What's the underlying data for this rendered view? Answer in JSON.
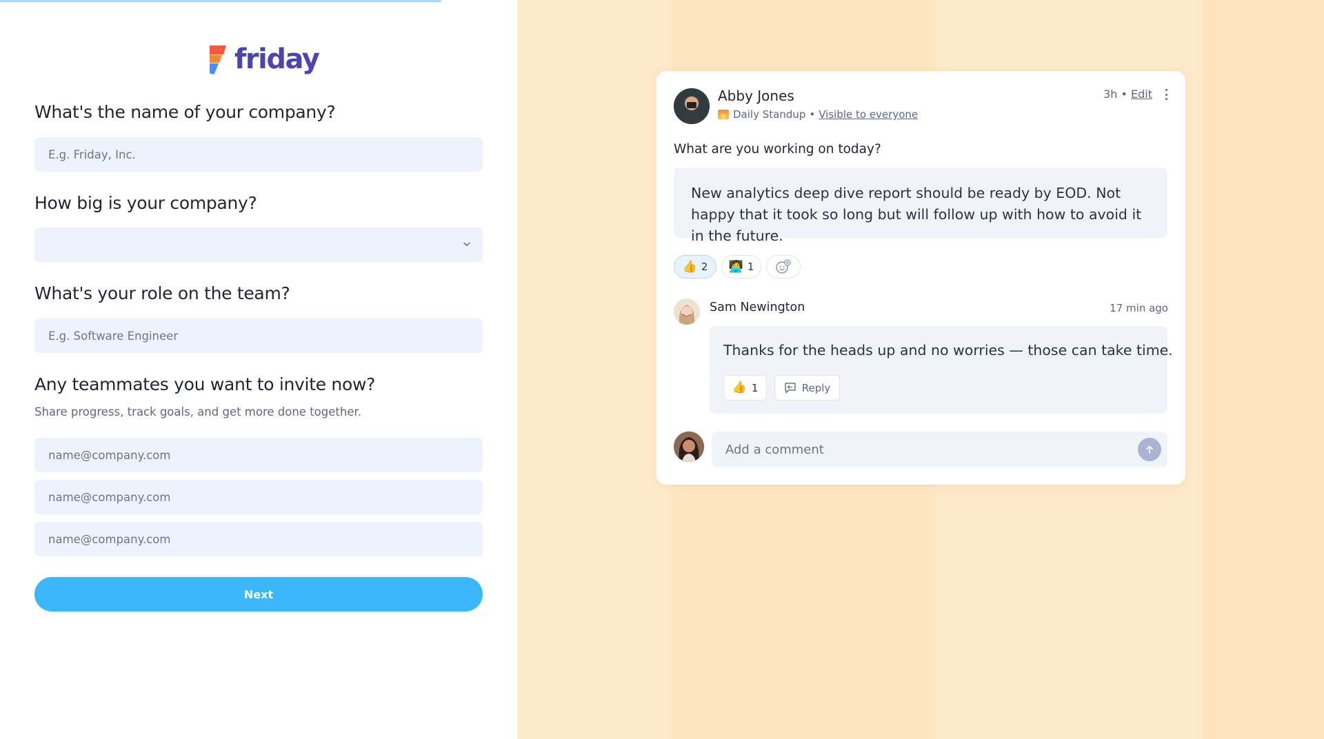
{
  "brand": {
    "name": "friday"
  },
  "form": {
    "company_name": {
      "question": "What's the name of your company?",
      "value": "",
      "placeholder": "E.g. Friday, Inc."
    },
    "company_size": {
      "question": "How big is your company?",
      "value": ""
    },
    "role": {
      "question": "What's your role on the team?",
      "value": "",
      "placeholder": "E.g. Software Engineer"
    },
    "invite": {
      "question": "Any teammates you want to invite now?",
      "subtitle": "Share progress, track goals, and get more done together.",
      "emails": [
        {
          "value": "",
          "placeholder": "name@company.com"
        },
        {
          "value": "",
          "placeholder": "name@company.com"
        },
        {
          "value": "",
          "placeholder": "name@company.com"
        }
      ]
    },
    "next_label": "Next"
  },
  "post": {
    "author": "Abby Jones",
    "channel": "Daily Standup",
    "separator": "•",
    "visibility": "Visible to everyone",
    "time": "3h",
    "edit_label": "Edit",
    "prompt": "What are you working on today?",
    "answer": "New analytics deep dive report should be ready by EOD. Not happy that it took so long but will follow up with how to avoid it in the future.",
    "reactions": [
      {
        "emoji": "👍",
        "count": "2"
      },
      {
        "emoji": "🧑‍💻",
        "count": "1"
      }
    ],
    "comment": {
      "author": "Sam Newington",
      "time": "17 min ago",
      "text": "Thanks for the heads up and no worries — those can take time.",
      "reaction": {
        "emoji": "👍",
        "count": "1"
      },
      "reply_label": "Reply"
    },
    "new_comment": {
      "value": "",
      "placeholder": "Add a comment"
    }
  },
  "colors": {
    "brand": "#4a45b0",
    "primary_button": "#3bb8fb",
    "field_bg": "#eef2fc",
    "panel_bg": "#fde9c9"
  },
  "icons": {
    "logo": "friday-logo-icon",
    "select": "chevron-down-icon",
    "more": "more-vertical-icon",
    "add_reaction": "add-reaction-icon",
    "reply": "reply-icon",
    "send": "arrow-up-icon"
  }
}
